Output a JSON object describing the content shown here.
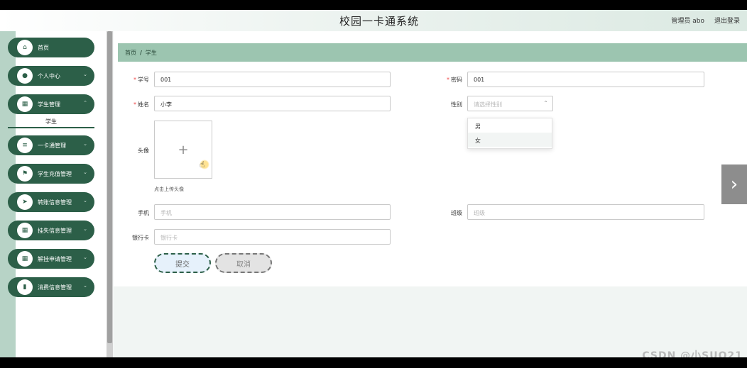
{
  "app": {
    "title": "校园一卡通系统"
  },
  "header": {
    "user_role": "管理员",
    "username": "abo",
    "logout": "退出登录"
  },
  "sidebar": {
    "items": [
      {
        "label": "首页",
        "icon": "home-icon",
        "glyph": "⌂"
      },
      {
        "label": "个人中心",
        "icon": "user-icon",
        "glyph": "●"
      },
      {
        "label": "学生管理",
        "icon": "grid-icon",
        "glyph": "▦",
        "sub": "学生"
      },
      {
        "label": "一卡通管理",
        "icon": "card-icon",
        "glyph": "≡"
      },
      {
        "label": "学生充值管理",
        "icon": "flag-icon",
        "glyph": "⚑"
      },
      {
        "label": "转账信息管理",
        "icon": "send-icon",
        "glyph": "➤"
      },
      {
        "label": "挂失信息管理",
        "icon": "grid-icon",
        "glyph": "▦"
      },
      {
        "label": "解挂申请管理",
        "icon": "grid-icon",
        "glyph": "▦"
      },
      {
        "label": "消费信息管理",
        "icon": "doc-icon",
        "glyph": "▮"
      }
    ]
  },
  "breadcrumb": {
    "home": "首页",
    "current": "学生"
  },
  "form": {
    "student_id": {
      "label": "学号",
      "value": "001"
    },
    "password": {
      "label": "密码",
      "value": "001"
    },
    "name": {
      "label": "姓名",
      "value": "小李"
    },
    "gender": {
      "label": "性别",
      "placeholder": "请选择性别",
      "options": [
        "男",
        "女"
      ]
    },
    "avatar": {
      "label": "头像",
      "tip": "点击上传头像"
    },
    "phone": {
      "label": "手机",
      "placeholder": "手机"
    },
    "class": {
      "label": "班级",
      "placeholder": "班级"
    },
    "bank_card": {
      "label": "银行卡",
      "placeholder": "银行卡"
    },
    "submit_label": "提交",
    "cancel_label": "取消"
  },
  "watermark": "CSDN @小SUO21",
  "colors": {
    "accent": "#2c5f48",
    "breadcrumb_bg": "#9cc5b0"
  }
}
